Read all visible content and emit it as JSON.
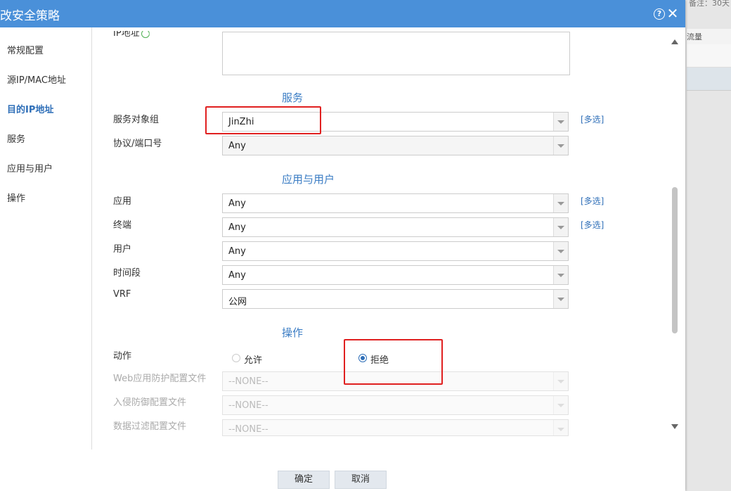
{
  "background": {
    "top_text": "备注：30天",
    "column_header": "流量"
  },
  "dialog": {
    "title": "改安全策略",
    "help_glyph": "?",
    "close_glyph": "✕"
  },
  "sidebar": {
    "items": [
      {
        "label": "常规配置"
      },
      {
        "label": "源IP/MAC地址"
      },
      {
        "label": "目的IP地址",
        "active": true
      },
      {
        "label": "服务"
      },
      {
        "label": "应用与用户"
      },
      {
        "label": "操作"
      }
    ]
  },
  "form": {
    "ip_field_label": "IP地址",
    "service_section": "服务",
    "service_group_label": "服务对象组",
    "service_group_value": "JinZhi",
    "protocol_label": "协议/端口号",
    "protocol_value": "Any",
    "app_user_section": "应用与用户",
    "app_label": "应用",
    "app_value": "Any",
    "terminal_label": "终端",
    "terminal_value": "Any",
    "user_label": "用户",
    "user_value": "Any",
    "time_label": "时间段",
    "time_value": "Any",
    "vrf_label": "VRF",
    "vrf_value": "公网",
    "operation_section": "操作",
    "action_label": "动作",
    "action_allow": "允许",
    "action_deny": "拒绝",
    "action_selected": "拒绝",
    "waf_label": "Web应用防护配置文件",
    "waf_value": "--NONE--",
    "ips_label": "入侵防御配置文件",
    "ips_value": "--NONE--",
    "filter_label": "数据过滤配置文件",
    "filter_value": "--NONE--",
    "multi_select": "[多选]"
  },
  "footer": {
    "ok_label": "确定",
    "cancel_label": "取消"
  },
  "colors": {
    "titlebar": "#4a90d9",
    "accent": "#2f6fb8",
    "highlight": "#e02020"
  }
}
